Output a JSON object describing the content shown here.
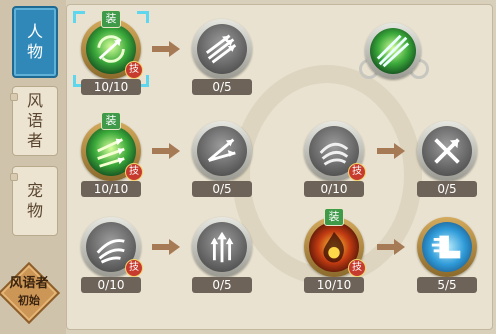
{
  "tabs": [
    {
      "id": "character",
      "label_chars": [
        "人",
        "物"
      ],
      "active": true
    },
    {
      "id": "windcaller",
      "label_chars": [
        "风",
        "语",
        "者"
      ],
      "active": false
    },
    {
      "id": "pet",
      "label_chars": [
        "宠",
        "物"
      ],
      "active": false
    }
  ],
  "class_badge": {
    "line1": "风语者",
    "line2": "初始"
  },
  "badges": {
    "equip": "装",
    "skill": "技"
  },
  "skills": [
    {
      "id": "wind-arrow-spin",
      "level": "10/10",
      "equipped": true,
      "has_skill_badge": true,
      "selected": true,
      "style": "green",
      "icon": "spinning-arrow-icon"
    },
    {
      "id": "triple-arrow-upgrade",
      "level": "0/5",
      "equipped": false,
      "has_skill_badge": false,
      "selected": false,
      "style": "grey",
      "icon": "triple-arrow-icon"
    },
    {
      "id": "arrow-volley",
      "level": "10/10",
      "equipped": true,
      "has_skill_badge": true,
      "selected": false,
      "style": "green",
      "icon": "arrow-volley-icon"
    },
    {
      "id": "split-arrow-upgrade",
      "level": "0/5",
      "equipped": false,
      "has_skill_badge": false,
      "selected": false,
      "style": "grey",
      "icon": "split-arrow-icon"
    },
    {
      "id": "gale-burst",
      "level": "0/10",
      "equipped": false,
      "has_skill_badge": true,
      "selected": false,
      "style": "grey",
      "icon": "whirlwind-icon"
    },
    {
      "id": "cross-blade-upgrade",
      "level": "0/5",
      "equipped": false,
      "has_skill_badge": false,
      "selected": false,
      "style": "grey",
      "icon": "crossed-blades-icon"
    },
    {
      "id": "wind-slash",
      "level": "0/10",
      "equipped": false,
      "has_skill_badge": true,
      "selected": false,
      "style": "grey",
      "icon": "wind-slash-icon"
    },
    {
      "id": "trident-upgrade",
      "level": "0/5",
      "equipped": false,
      "has_skill_badge": false,
      "selected": false,
      "style": "grey",
      "icon": "trident-icon"
    },
    {
      "id": "flame-burst",
      "level": "10/10",
      "equipped": true,
      "has_skill_badge": true,
      "selected": false,
      "style": "red",
      "icon": "flame-burst-icon"
    },
    {
      "id": "swift-boot",
      "level": "5/5",
      "equipped": false,
      "has_skill_badge": false,
      "selected": false,
      "style": "blue",
      "icon": "winged-boot-icon"
    }
  ],
  "ultimate": {
    "icon": "wind-slash-ultimate-icon",
    "style": "green"
  }
}
